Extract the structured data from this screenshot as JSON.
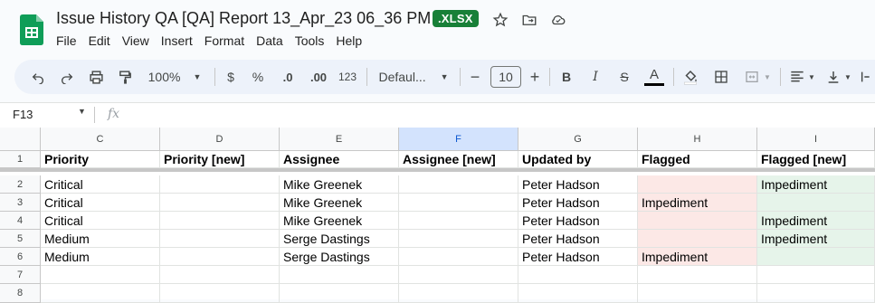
{
  "doc": {
    "title": "Issue History QA [QA] Report 13_Apr_23 06_36 PM",
    "badge": ".XLSX"
  },
  "menu": [
    "File",
    "Edit",
    "View",
    "Insert",
    "Format",
    "Data",
    "Tools",
    "Help"
  ],
  "toolbar": {
    "zoom": "100%",
    "currency": "$",
    "percent": "%",
    "dec_decrease": ".0",
    "dec_increase": ".00",
    "number_format": "123",
    "font": "Defaul...",
    "font_size": "10",
    "bold": "B",
    "italic": "I",
    "strike": "S",
    "text_color_letter": "A",
    "accent_text_color": "#000000"
  },
  "formula_bar": {
    "name_box": "F13",
    "fx": "fx"
  },
  "columns": [
    "C",
    "D",
    "E",
    "F",
    "G",
    "H",
    "I"
  ],
  "selected_column": "F",
  "rows": [
    "1",
    "2",
    "3",
    "4",
    "5",
    "6",
    "7",
    "8"
  ],
  "cells": [
    [
      "Priority",
      "Priority [new]",
      "Assignee",
      "Assignee [new]",
      "Updated by",
      "Flagged",
      "Flagged [new]"
    ],
    [
      "Critical",
      "",
      "Mike Greenek",
      "",
      "Peter Hadson",
      "",
      "Impediment"
    ],
    [
      "Critical",
      "",
      "Mike Greenek",
      "",
      "Peter Hadson",
      "Impediment",
      ""
    ],
    [
      "Critical",
      "",
      "Mike Greenek",
      "",
      "Peter Hadson",
      "",
      "Impediment"
    ],
    [
      "Medium",
      "",
      "Serge Dastings",
      "",
      "Peter Hadson",
      "",
      "Impediment"
    ],
    [
      "Medium",
      "",
      "Serge Dastings",
      "",
      "Peter Hadson",
      "Impediment",
      ""
    ],
    [
      "",
      "",
      "",
      "",
      "",
      "",
      ""
    ],
    [
      "",
      "",
      "",
      "",
      "",
      "",
      ""
    ]
  ],
  "colors": {
    "flag_old_bg": "#fce8e6",
    "flag_new_bg": "#e6f4ea",
    "badge_bg": "#188038",
    "sheets_green": "#0f9d58"
  }
}
